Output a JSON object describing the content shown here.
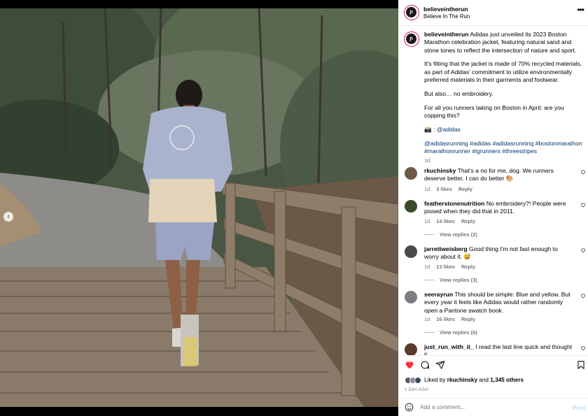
{
  "account": {
    "username": "believeintherun",
    "subtitle": "Believe In The Run",
    "avatar_text": "ɲ",
    "more_icon": "more-horizontal-icon"
  },
  "post": {
    "caption_paragraphs": [
      "Adidas just unveiled its 2023 Boston Marathon celebration jacket, featuring natural sand and stone tones to reflect the intersection of nature and sport.",
      "It's fitting that the jacket is made of 70% recycled materials, as part of Adidas' commitment to utilize environmentally preferred materials in their garments and footwear.",
      "But also… no embroidery.",
      "For all you runners taking on Boston in April: are you copping this?",
      "📸 : @adidas",
      "@adidasrunning #adidas #adidasrunning #bostonmarathon #marathonrunner #igrunners #threestripes"
    ],
    "time": "1d",
    "carousel": {
      "dots": 4,
      "active_index": 3
    }
  },
  "comments": [
    {
      "username": "rkuchinsky",
      "text": "That's a no for me, dog. We runners deserve better. I can do better 🎨",
      "time": "1d",
      "likes": "3 likes",
      "reply": "Reply",
      "avatar_color": "#6b5a4a"
    },
    {
      "username": "featherstonenutrition",
      "text": "No embroidery?! People were pissed when they did that in 2011.",
      "time": "1d",
      "likes": "14 likes",
      "reply": "Reply",
      "view_replies": "View replies (2)",
      "avatar_color": "#3b4a2c"
    },
    {
      "username": "jarrettweisberg",
      "text": "Good thing I'm not fast enough to worry about it. 😅",
      "time": "1d",
      "likes": "13 likes",
      "reply": "Reply",
      "view_replies": "View replies (3)",
      "avatar_color": "#4a4a4a"
    },
    {
      "username": "seerayrun",
      "text": "This should be simple: Blue and yellow. But every year it feels like Adidas would rather randomly open a Pantone swatch book.",
      "time": "1d",
      "likes": "16 likes",
      "reply": "Reply",
      "view_replies": "View replies (6)",
      "avatar_color": "#7a7e82"
    },
    {
      "username": "just_run_with_it_",
      "text": "I read the last line quick and thought it",
      "avatar_color": "#5a3a2a"
    }
  ],
  "actions": {
    "liked": true,
    "like_color": "#ff3040",
    "liked_by_prefix": "Liked by",
    "liked_by_user": "rkuchinsky",
    "and": "and",
    "others": "1,345 others",
    "time_ago": "1 DAY AGO"
  },
  "add_comment": {
    "placeholder": "Add a comment...",
    "post_label": "Post",
    "post_color": "#b3dbff"
  }
}
